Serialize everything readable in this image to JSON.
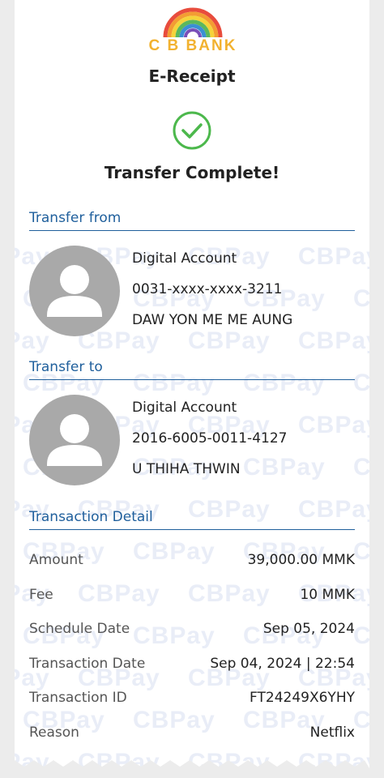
{
  "brand": {
    "name": "C B BANK",
    "colors": {
      "gold": "#f2b230",
      "blue": "#1f5f9c",
      "success": "#4cb84c"
    }
  },
  "receipt": {
    "title": "E-Receipt",
    "status": "Transfer Complete!",
    "status_icon": "check-circle-icon"
  },
  "transfer_from": {
    "heading": "Transfer from",
    "account_type": "Digital Account",
    "account_number": "0031-xxxx-xxxx-3211",
    "name": "DAW YON ME ME AUNG"
  },
  "transfer_to": {
    "heading": "Transfer to",
    "account_type": "Digital Account",
    "account_number": "2016-6005-0011-4127",
    "name": "U THIHA THWIN"
  },
  "transaction_detail": {
    "heading": "Transaction Detail",
    "rows": [
      {
        "label": "Amount",
        "value": "39,000.00 MMK"
      },
      {
        "label": "Fee",
        "value": "10 MMK"
      },
      {
        "label": "Schedule Date",
        "value": "Sep 05, 2024"
      },
      {
        "label": "Transaction Date",
        "value": "Sep 04, 2024 | 22:54"
      },
      {
        "label": "Transaction ID",
        "value": "FT24249X6YHY"
      },
      {
        "label": "Reason",
        "value": "Netflix"
      }
    ]
  },
  "watermark_text": "CBPay"
}
